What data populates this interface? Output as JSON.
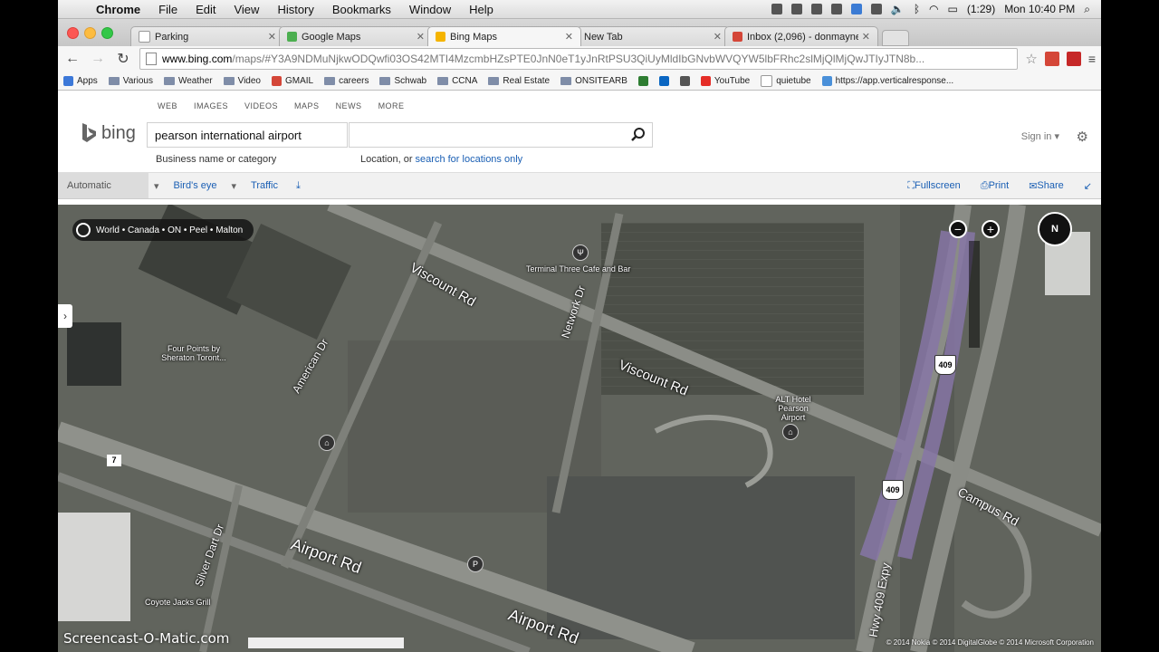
{
  "menubar": {
    "app": "Chrome",
    "items": [
      "File",
      "Edit",
      "View",
      "History",
      "Bookmarks",
      "Window",
      "Help"
    ],
    "battery": "(1:29)",
    "clock": "Mon 10:40 PM"
  },
  "tabs": [
    {
      "title": "Parking",
      "favicon_color": "#ffffff",
      "active": false
    },
    {
      "title": "Google Maps",
      "favicon_color": "#4caf50",
      "active": false
    },
    {
      "title": "Bing Maps",
      "favicon_color": "#f5b400",
      "active": true
    },
    {
      "title": "New Tab",
      "favicon_color": "#e0e0e0",
      "active": false
    },
    {
      "title": "Inbox (2,096) - donmayne",
      "favicon_color": "#d44638",
      "active": false
    }
  ],
  "address": {
    "host": "www.bing.com",
    "path": "/maps/#Y3A9NDMuNjkwODQwfi03OS42MTI4MzcmbHZsPTE0JnN0eT1yJnRtPSU3QiUyMldIbGNvbWVQYW5lbFRhc2slMjQlMjQwJTIyJTN8b..."
  },
  "bookmarks": [
    {
      "label": "Apps",
      "icon": "apps-grid-icon"
    },
    {
      "label": "Various",
      "icon": "folder-icon"
    },
    {
      "label": "Weather",
      "icon": "folder-icon"
    },
    {
      "label": "Video",
      "icon": "folder-icon"
    },
    {
      "label": "GMAIL",
      "icon": "gmail-icon"
    },
    {
      "label": "careers",
      "icon": "folder-icon"
    },
    {
      "label": "Schwab",
      "icon": "folder-icon"
    },
    {
      "label": "CCNA",
      "icon": "folder-icon"
    },
    {
      "label": "Real Estate",
      "icon": "folder-icon"
    },
    {
      "label": "ONSITEARB",
      "icon": "folder-icon"
    },
    {
      "label": "YouTube",
      "icon": "youtube-icon"
    },
    {
      "label": "quietube",
      "icon": "page-icon"
    },
    {
      "label": "https://app.verticalresponse...",
      "icon": "vr-icon"
    }
  ],
  "bing": {
    "scopes": [
      "WEB",
      "IMAGES",
      "VIDEOS",
      "MAPS",
      "NEWS",
      "MORE"
    ],
    "logo": "bing",
    "what_value": "pearson international airport",
    "where_value": "",
    "what_hint": "Business name or category",
    "where_hint": "Location, or",
    "where_hint_link": "search for locations only",
    "signin": "Sign in",
    "signin_caret": "▾"
  },
  "map_toolbar": {
    "automatic": "Automatic",
    "birdseye": "Bird's eye",
    "traffic": "Traffic",
    "fullscreen": "Fullscreen",
    "print": "Print",
    "share": "Share"
  },
  "map": {
    "breadcrumb": "World • Canada • ON • Peel • Malton",
    "compass": "N",
    "roads": [
      {
        "name": "Viscount Rd",
        "id": "viscount-1"
      },
      {
        "name": "Viscount Rd",
        "id": "viscount-2"
      },
      {
        "name": "Network Dr",
        "id": "network"
      },
      {
        "name": "American Dr",
        "id": "american"
      },
      {
        "name": "Airport Rd",
        "id": "airport-1"
      },
      {
        "name": "Airport Rd",
        "id": "airport-2"
      },
      {
        "name": "Silver Dart Dr",
        "id": "silverdart"
      },
      {
        "name": "Campus Rd",
        "id": "campus"
      },
      {
        "name": "Hwy 409 Expy",
        "id": "expy"
      }
    ],
    "pois": [
      {
        "name": "Terminal Three Cafe and Bar",
        "id": "cafe"
      },
      {
        "name": "Four Points by Sheraton Toront...",
        "id": "fourpoints"
      },
      {
        "name": "ALT Hotel Pearson Airport",
        "id": "alt"
      },
      {
        "name": "Coyote Jacks Grill",
        "id": "coyote"
      }
    ],
    "shields": [
      "409",
      "409",
      "7"
    ],
    "copyright": "© 2014 Nokia   © 2014 DigitalGlobe   © 2014 Microsoft Corporation"
  },
  "watermark": "Screencast-O-Matic.com",
  "colors": {
    "bing_link": "#1a5fb4",
    "map_bg": "#5f625c"
  }
}
